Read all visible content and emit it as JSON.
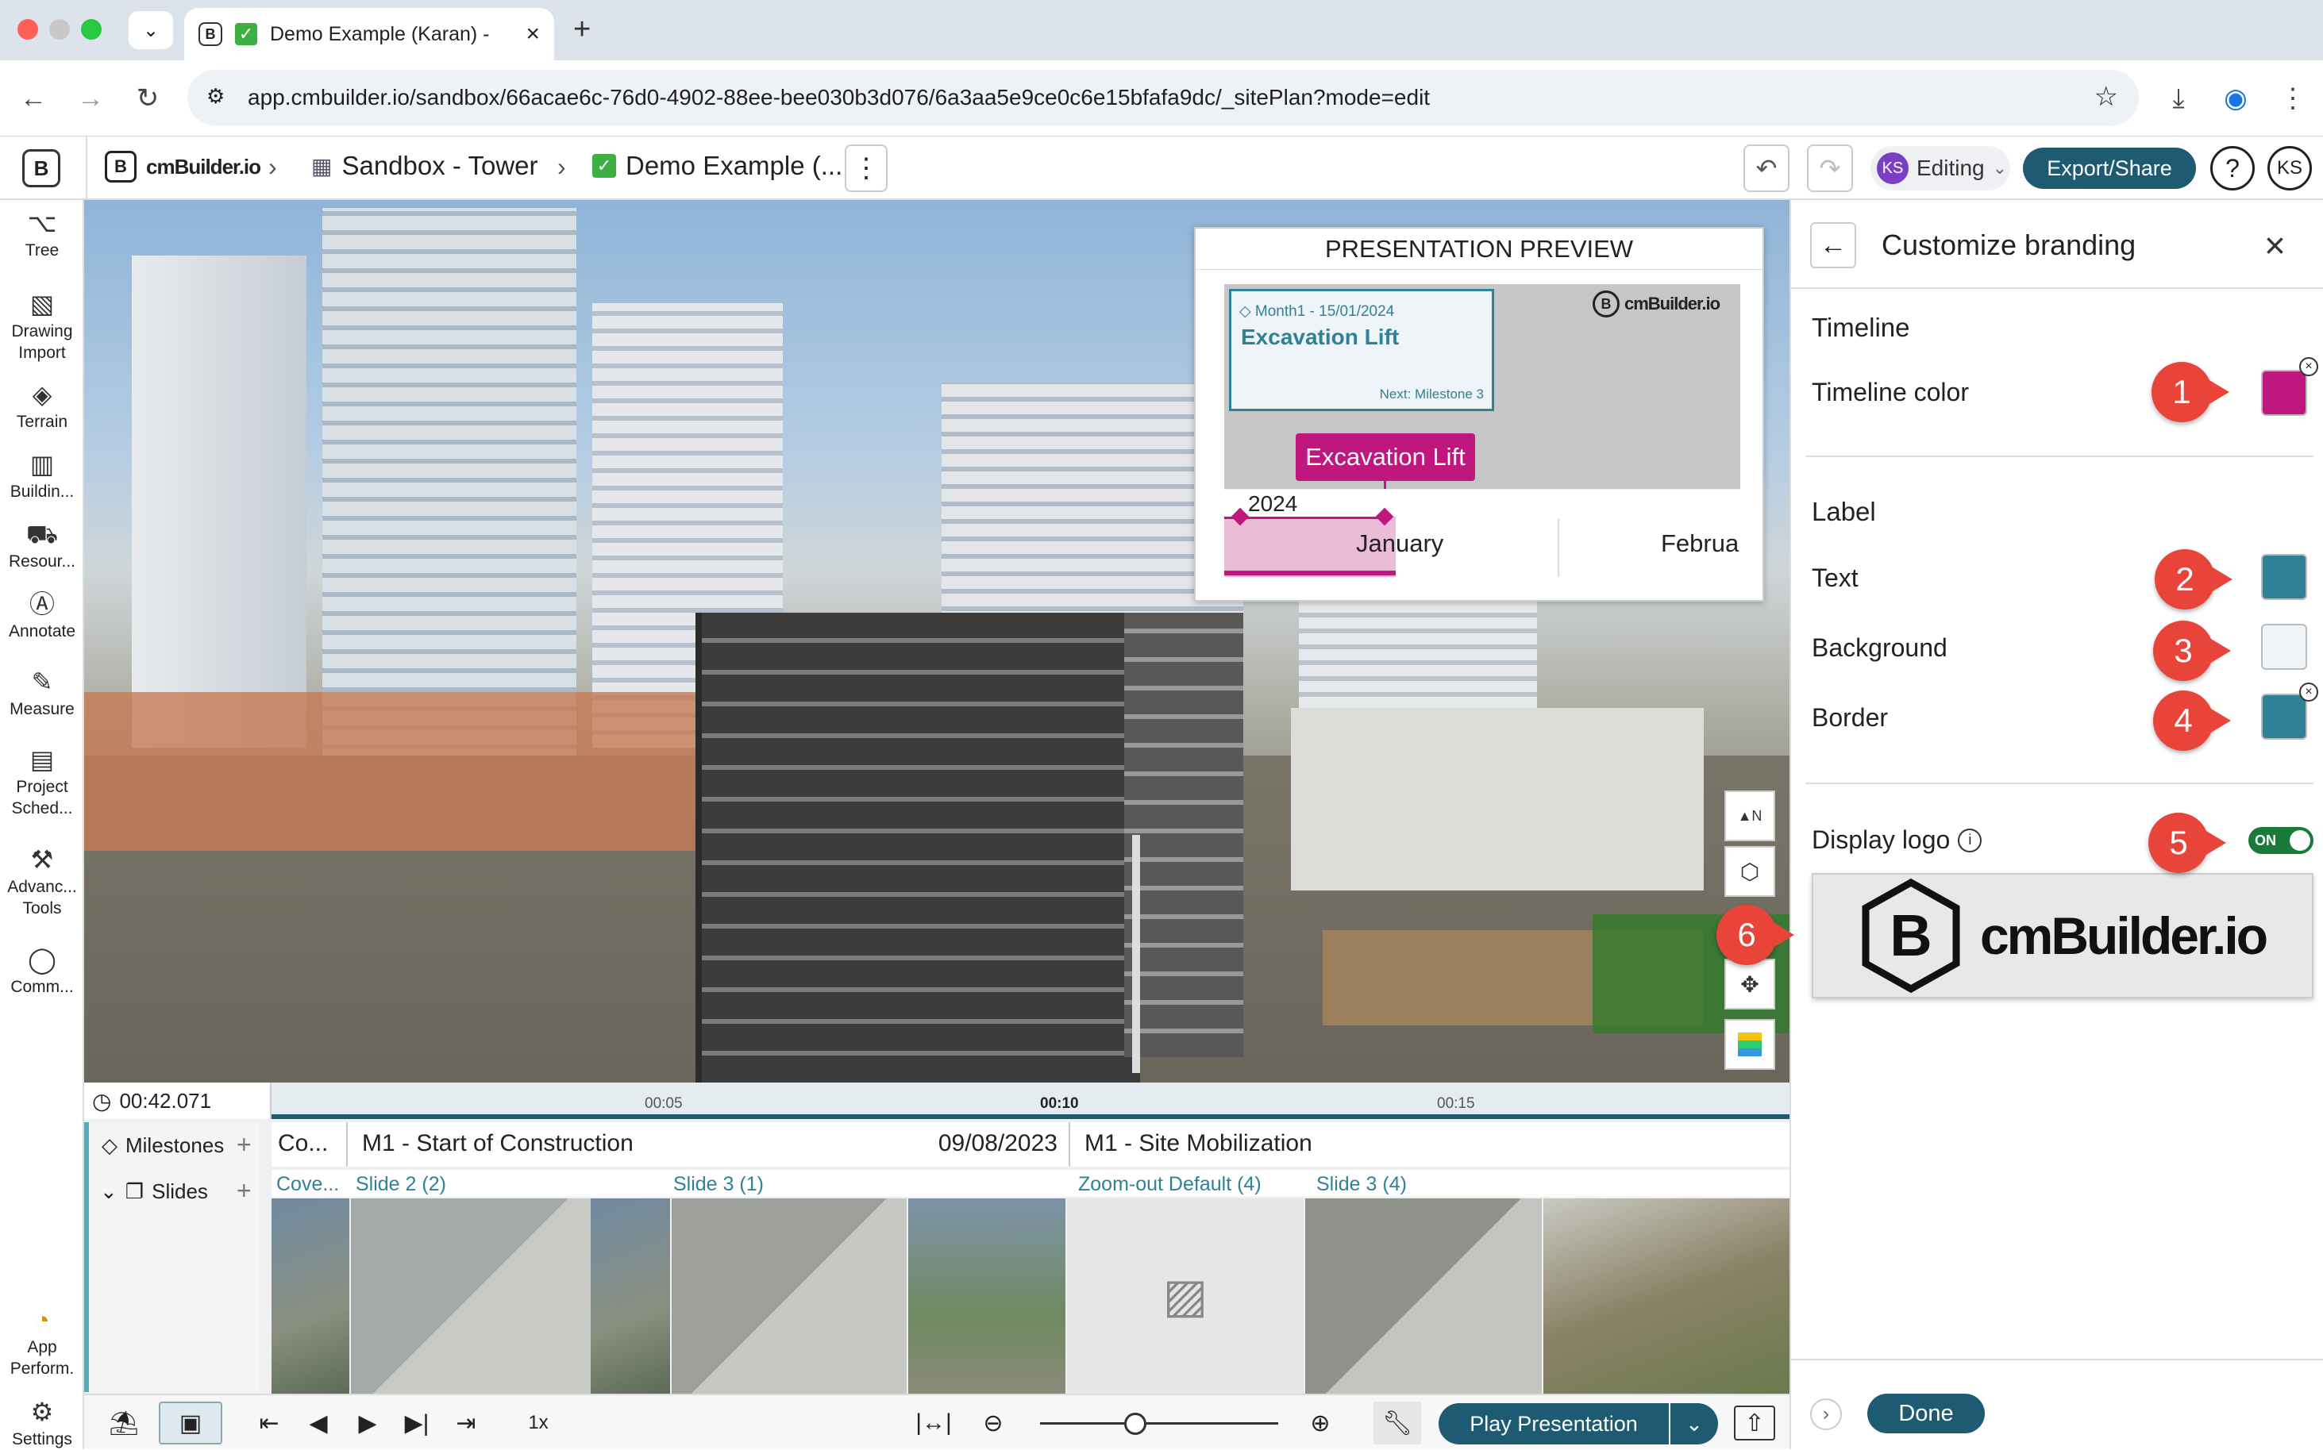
{
  "browser": {
    "tab_title": "Demo Example (Karan) -",
    "url": "app.cmbuilder.io/sandbox/66acae6c-76d0-4902-88ee-bee030b3d076/6a3aa5e9ce0c6e15bfafa9dc/_sitePlan?mode=edit"
  },
  "header": {
    "logo_text": "cmBuilder.io",
    "crumb1": "Sandbox - Tower",
    "crumb2": "Demo Example (...",
    "editing_badge": "KS",
    "editing_label": "Editing",
    "export_label": "Export/Share",
    "help_label": "?",
    "avatar": "KS"
  },
  "left_toolbar": [
    {
      "label": "Tree",
      "icon": "tree-icon"
    },
    {
      "label": "Drawing Import",
      "icon": "drawing-import-icon"
    },
    {
      "label": "Terrain",
      "icon": "terrain-icon"
    },
    {
      "label": "Buildin...",
      "icon": "building-icon"
    },
    {
      "label": "Resour...",
      "icon": "resources-icon"
    },
    {
      "label": "Annotate",
      "icon": "annotate-icon"
    },
    {
      "label": "Measure",
      "icon": "measure-icon"
    },
    {
      "label": "Project Sched...",
      "icon": "calendar-icon"
    },
    {
      "label": "Advanc... Tools",
      "icon": "advanced-tools-icon"
    },
    {
      "label": "Comm...",
      "icon": "comment-icon"
    },
    {
      "label": "App Perform.",
      "icon": "performance-icon"
    },
    {
      "label": "Settings",
      "icon": "settings-icon"
    }
  ],
  "preview": {
    "title": "PRESENTATION PREVIEW",
    "card_date": "Month1 - 15/01/2024",
    "card_title": "Excavation Lift",
    "card_next": "Next: Milestone 3",
    "logo_text": "cmBuilder.io",
    "label": "Excavation Lift",
    "year": "2024",
    "month1": "January",
    "month2": "Februa"
  },
  "panel": {
    "title": "Customize branding",
    "timeline_heading": "Timeline",
    "timeline_color_label": "Timeline color",
    "label_heading": "Label",
    "text_label": "Text",
    "background_label": "Background",
    "border_label": "Border",
    "display_logo_label": "Display logo",
    "toggle_text": "ON",
    "logo_text": "cmBuilder.io",
    "done_label": "Done",
    "markers": [
      "1",
      "2",
      "3",
      "4",
      "5",
      "6"
    ]
  },
  "colors": {
    "timeline": "#c0177f",
    "label_text": "#2f8296",
    "label_background": "#eef4f8",
    "label_border": "#2f8296",
    "accent": "#1e5a72"
  },
  "timeline": {
    "time": "00:42.071",
    "ticks": [
      "00:05",
      "00:10",
      "00:15"
    ],
    "milestones_label": "Milestones",
    "slides_label": "Slides",
    "milestone_cells": [
      {
        "title": "Co...",
        "date": ""
      },
      {
        "title": "M1 - Start of Construction",
        "date": "09/08/2023"
      },
      {
        "title": "M1 - Site Mobilization",
        "date": ""
      }
    ],
    "slide_cells": [
      "Cove...",
      "Slide 2 (2)",
      "Slide 3 (1)",
      "Zoom-out Default (4)",
      "Slide 3 (4)"
    ]
  },
  "bottom_toolbar": {
    "speed": "1x",
    "play_label": "Play Presentation",
    "zoom_level": 0.4
  }
}
